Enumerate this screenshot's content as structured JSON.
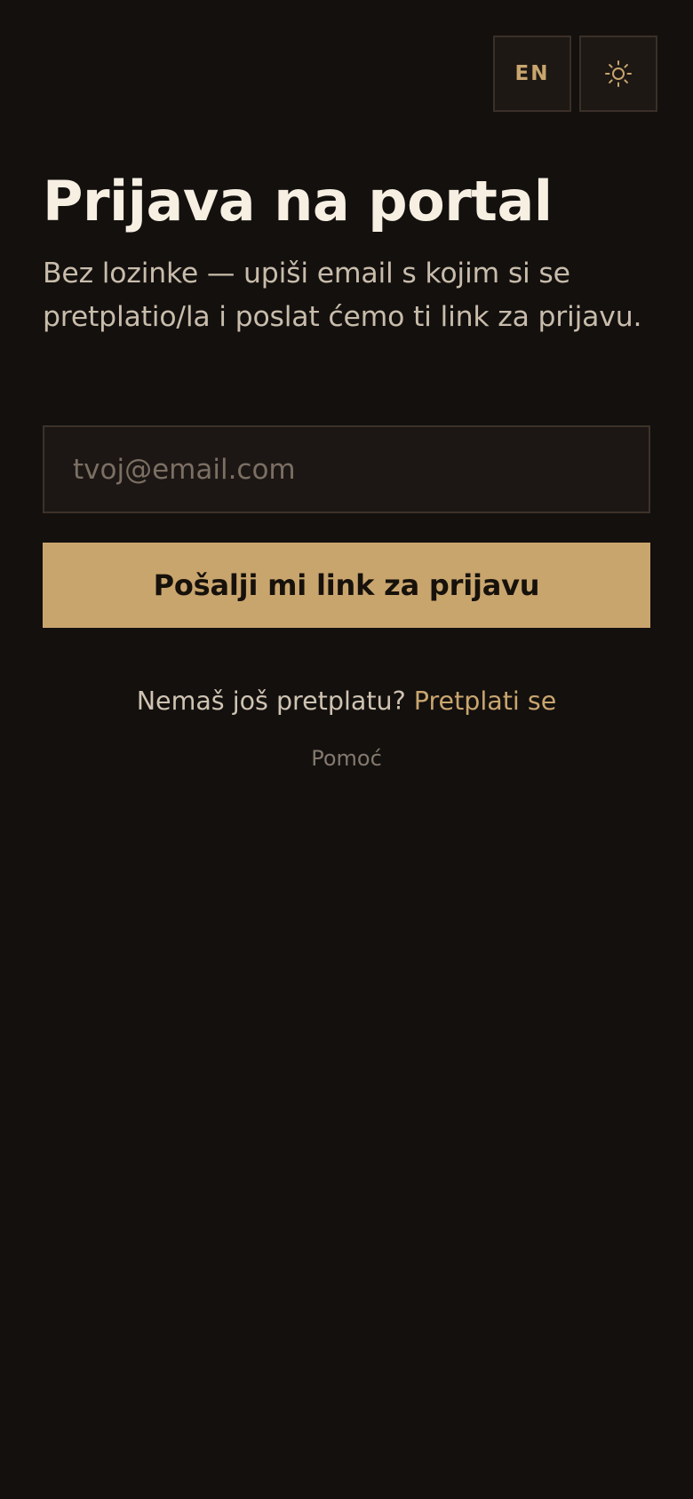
{
  "header": {
    "language_label": "EN",
    "theme_icon": "sun-icon"
  },
  "login": {
    "title": "Prijava na portal",
    "subtitle": "Bez lozinke — upiši email s kojim si se pretplatio/la i poslat ćemo ti link za prijavu.",
    "email_value": "",
    "email_placeholder": "tvoj@email.com",
    "submit_label": "Pošalji mi link za prijavu"
  },
  "footer": {
    "no_subscription_text": "Nemaš još pretplatu?",
    "subscribe_link": "Pretplati se",
    "help_link": "Pomoć"
  },
  "colors": {
    "background": "#13100e",
    "accent": "#c9a56e",
    "title_text": "#f6efe2",
    "muted_text": "#c8bcab"
  }
}
